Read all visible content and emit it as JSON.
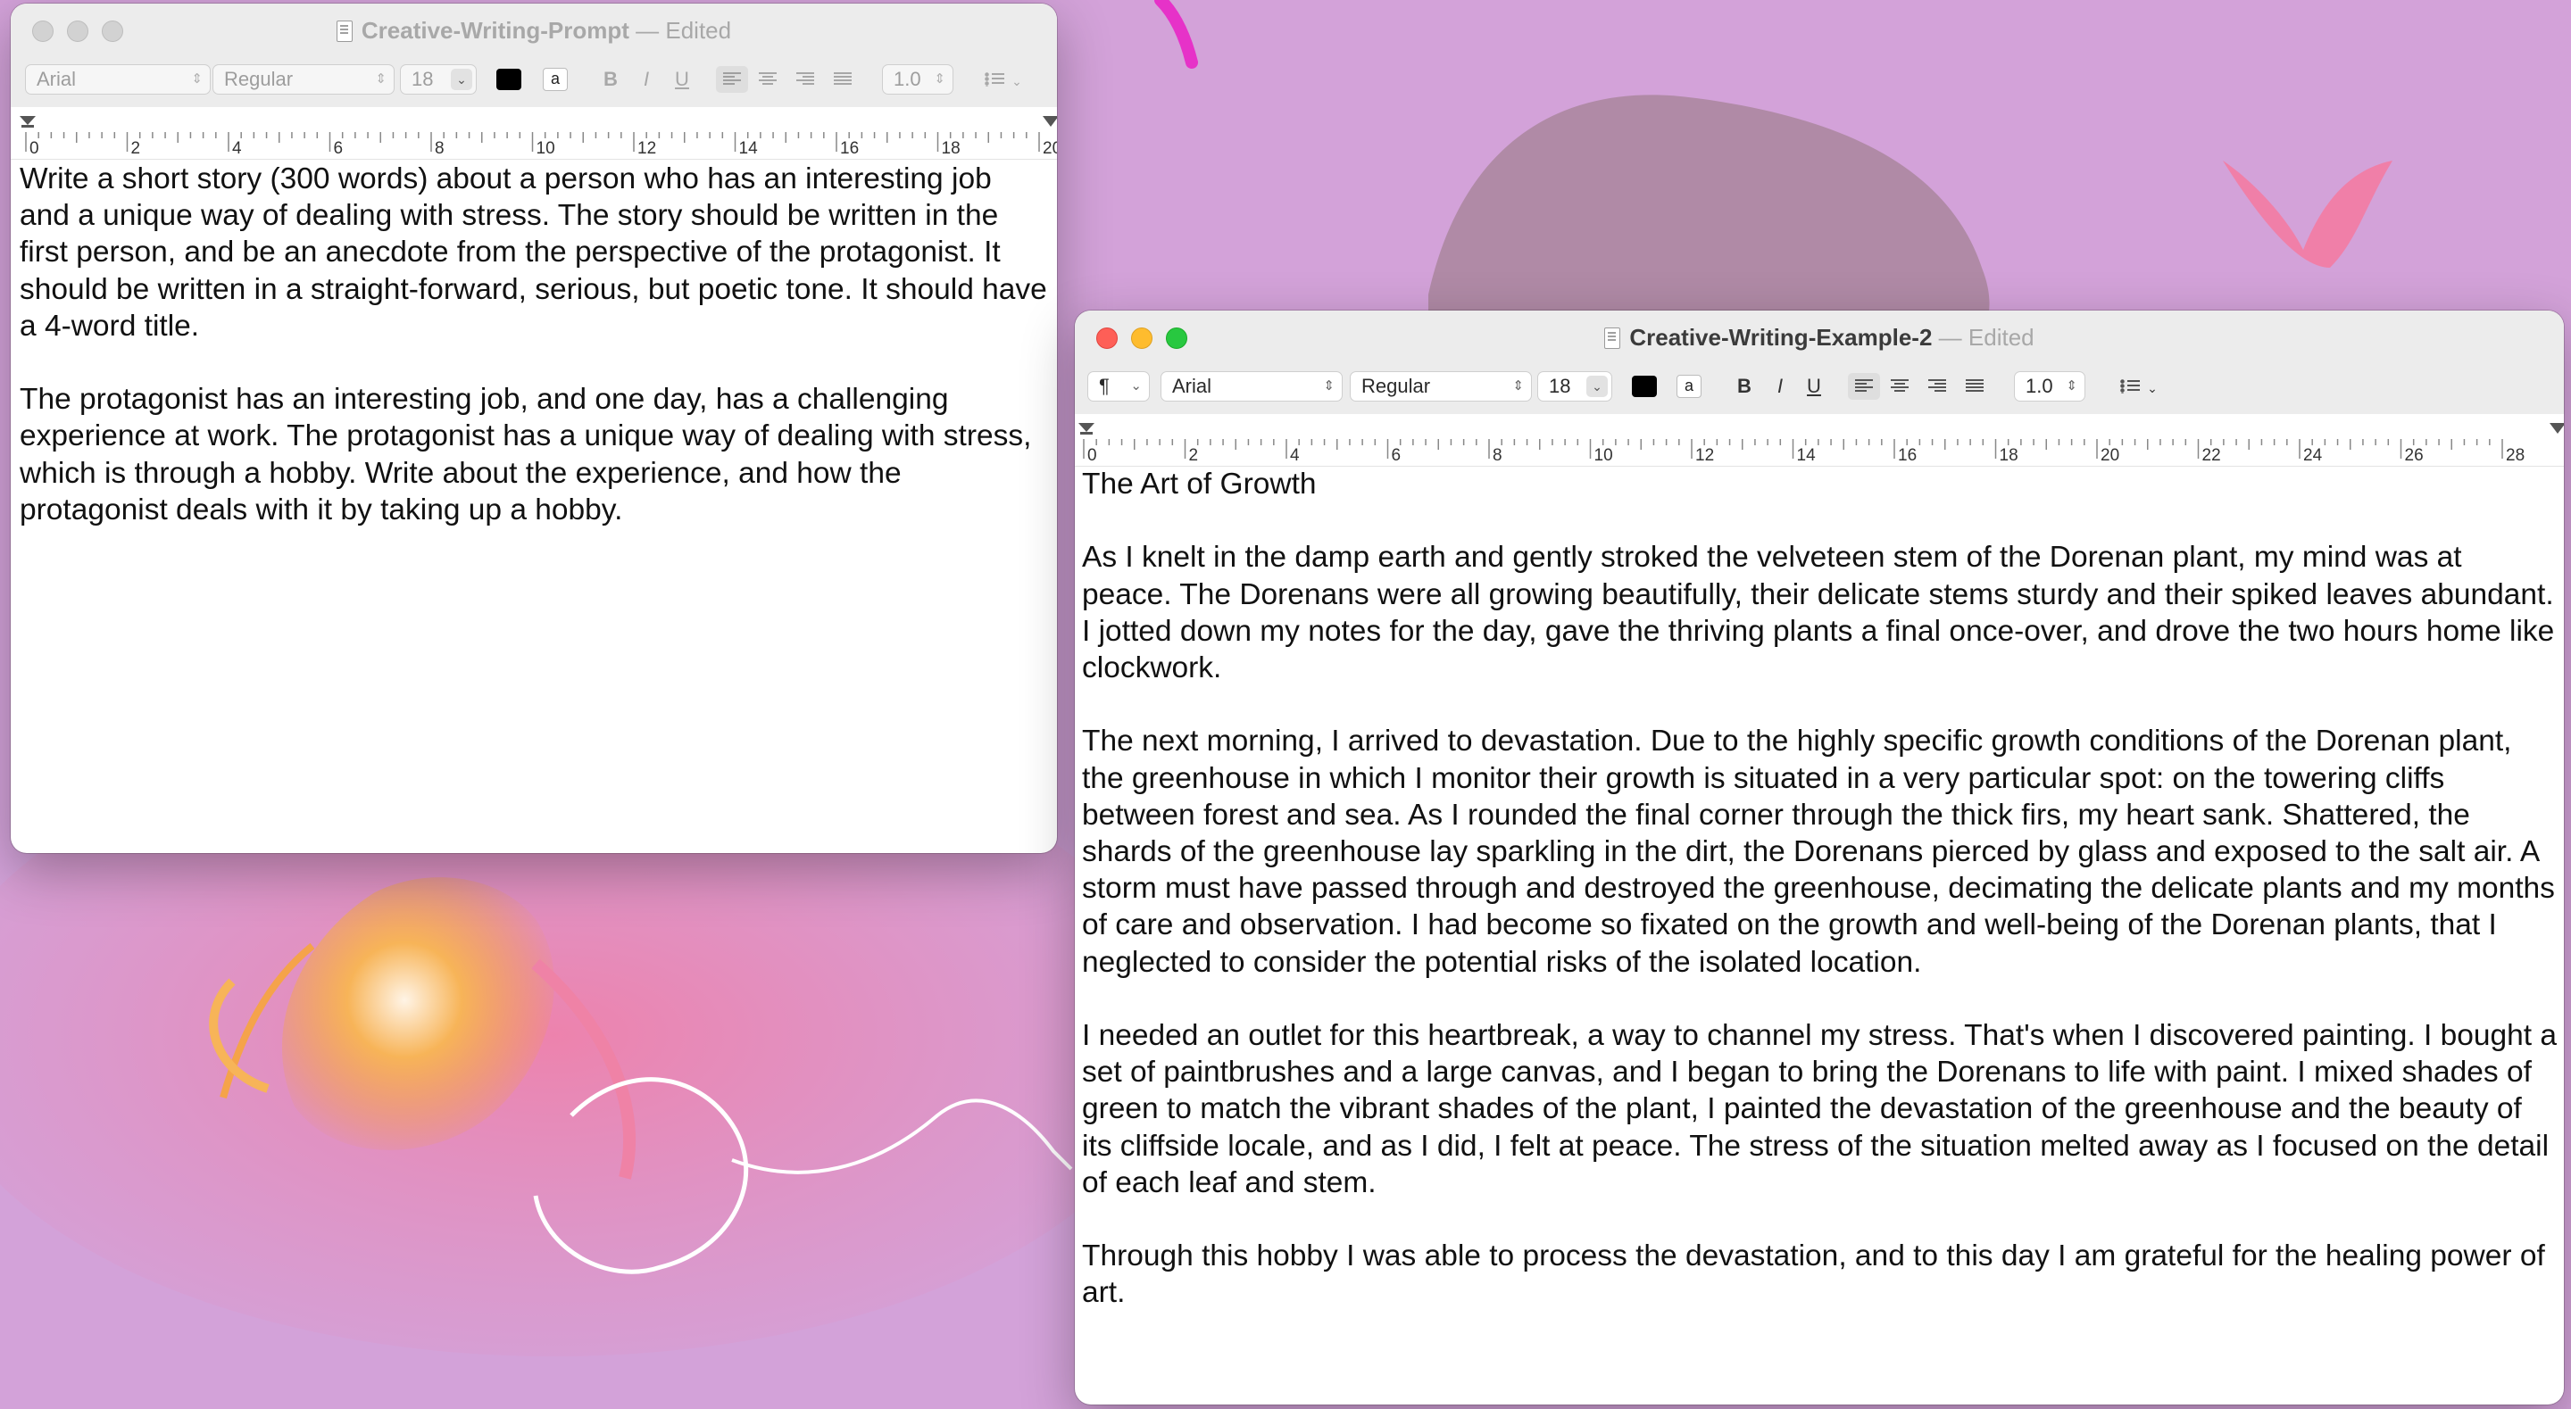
{
  "desktop": {
    "background_color": "#d3a2d9"
  },
  "windows": [
    {
      "id": "prompt",
      "title": "Creative-Writing-Prompt",
      "separator": "—",
      "status": "Edited",
      "toolbar": {
        "font": "Arial",
        "style": "Regular",
        "size": "18",
        "text_color": "#000000",
        "highlight_label": "a",
        "bold": "B",
        "italic": "I",
        "underline": "U",
        "spacing": "1.0"
      },
      "ruler": [
        "0",
        "2",
        "4",
        "6",
        "8",
        "10",
        "12",
        "14",
        "16",
        "18",
        "20"
      ],
      "text": "Write a short story (300 words) about a person who has an interesting job and a unique way of dealing with stress. The story should be written in the first person, and be an anecdote from the perspective of the protagonist. It should be written in a straight-forward, serious, but poetic tone. It should have a 4-word title.\n\nThe protagonist has an interesting job, and one day, has a challenging experience at work. The protagonist has a unique way of dealing with stress, which is through a hobby. Write about the experience, and how the protagonist deals with it by taking up a hobby."
    },
    {
      "id": "example2",
      "title": "Creative-Writing-Example-2",
      "separator": "—",
      "status": "Edited",
      "toolbar": {
        "paragraph_icon": "¶",
        "font": "Arial",
        "style": "Regular",
        "size": "18",
        "text_color": "#000000",
        "highlight_label": "a",
        "bold": "B",
        "italic": "I",
        "underline": "U",
        "spacing": "1.0"
      },
      "ruler": [
        "0",
        "2",
        "4",
        "6",
        "8",
        "10",
        "12",
        "14",
        "16",
        "18",
        "20",
        "22",
        "24",
        "26",
        "28"
      ],
      "text": "The Art of Growth\n\nAs I knelt in the damp earth and gently stroked the velveteen stem of the Dorenan plant, my mind was at peace. The Dorenans were all growing beautifully, their delicate stems sturdy and their spiked leaves abundant. I jotted down my notes for the day, gave the thriving plants a final once-over, and drove the two hours home like clockwork.\n\nThe next morning, I arrived to devastation. Due to the highly specific growth conditions of the Dorenan plant, the greenhouse in which I monitor their growth is situated in a very particular spot: on the towering cliffs between forest and sea. As I rounded the final corner through the thick firs, my heart sank. Shattered, the shards of the greenhouse lay sparkling in the dirt, the Dorenans pierced by glass and exposed to the salt air. A storm must have passed through and destroyed the greenhouse, decimating the delicate plants and my months of care and observation. I had become so fixated on the growth and well-being of the Dorenan plants, that I neglected to consider the potential risks of the isolated location.\n\nI needed an outlet for this heartbreak, a way to channel my stress. That's when I discovered painting. I bought a set of paintbrushes and a large canvas, and I began to bring the Dorenans to life with paint. I mixed shades of green to match the vibrant shades of the plant, I painted the devastation of the greenhouse and the beauty of its cliffside locale, and as I did, I felt at peace. The stress of the situation melted away as I focused on the detail of each leaf and stem.\n\nThrough this hobby I was able to process the devastation, and to this day I am grateful for the healing power of art."
    }
  ]
}
